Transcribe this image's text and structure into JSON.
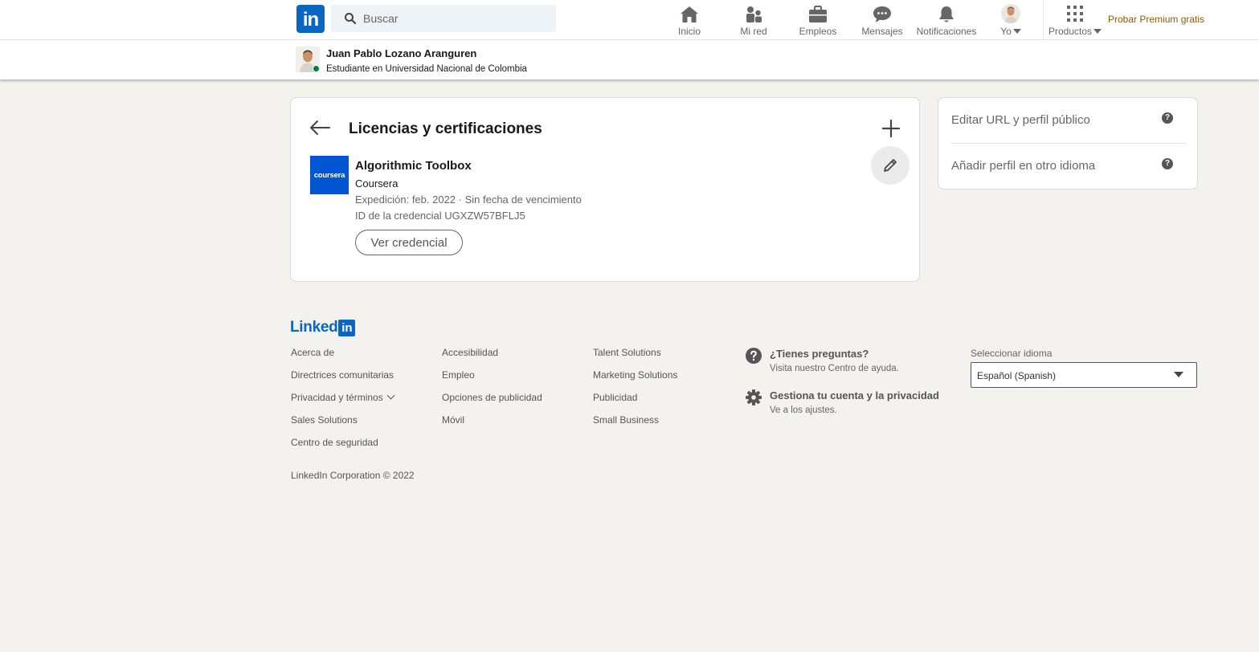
{
  "nav": {
    "logo_text": "in",
    "search_placeholder": "Buscar",
    "items": [
      {
        "label": "Inicio",
        "icon": "home-icon"
      },
      {
        "label": "Mi red",
        "icon": "my-network-icon"
      },
      {
        "label": "Empleos",
        "icon": "briefcase-icon"
      },
      {
        "label": "Mensajes",
        "icon": "messaging-icon"
      },
      {
        "label": "Notificaciones",
        "icon": "bell-icon"
      },
      {
        "label": "Yo",
        "icon": "avatar"
      },
      {
        "label": "Productos",
        "icon": "grid-icon"
      }
    ],
    "premium_label": "Probar Premium gratis"
  },
  "profile": {
    "name": "Juan Pablo Lozano Aranguren",
    "headline": "Estudiante en Universidad Nacional de Colombia",
    "online_color": "#057642"
  },
  "section": {
    "title": "Licencias y certificaciones",
    "certification": {
      "name": "Algorithmic Toolbox",
      "issuer": "Coursera",
      "issuer_logo_text": "coursera",
      "issued": "Expedición: feb. 2022 · Sin fecha de vencimiento",
      "credential_id": "ID de la credencial UGXZW57BFLJ5",
      "view_button": "Ver credencial"
    }
  },
  "sidebar": {
    "items": [
      {
        "label": "Editar URL y perfil público"
      },
      {
        "label": "Añadir perfil en otro idioma"
      }
    ]
  },
  "footer": {
    "logo_text": "Linked",
    "logo_box": "in",
    "col1": [
      "Acerca de",
      "Directrices comunitarias",
      "Privacidad y términos",
      "Sales Solutions",
      "Centro de seguridad"
    ],
    "col2": [
      "Accesibilidad",
      "Empleo",
      "Opciones de publicidad",
      "Móvil"
    ],
    "col3": [
      "Talent Solutions",
      "Marketing Solutions",
      "Publicidad",
      "Small Business"
    ],
    "help": {
      "title": "¿Tienes preguntas?",
      "subtitle": "Visita nuestro Centro de ayuda."
    },
    "account": {
      "title": "Gestiona tu cuenta y la privacidad",
      "subtitle": "Ve a los ajustes."
    },
    "language_label": "Seleccionar idioma",
    "language_value": "Español (Spanish)",
    "copyright": "LinkedIn Corporation © 2022"
  },
  "colors": {
    "brand": "#0a66c2",
    "coursera": "#0056d2",
    "premium": "#915907",
    "background": "#f3f2ef"
  }
}
